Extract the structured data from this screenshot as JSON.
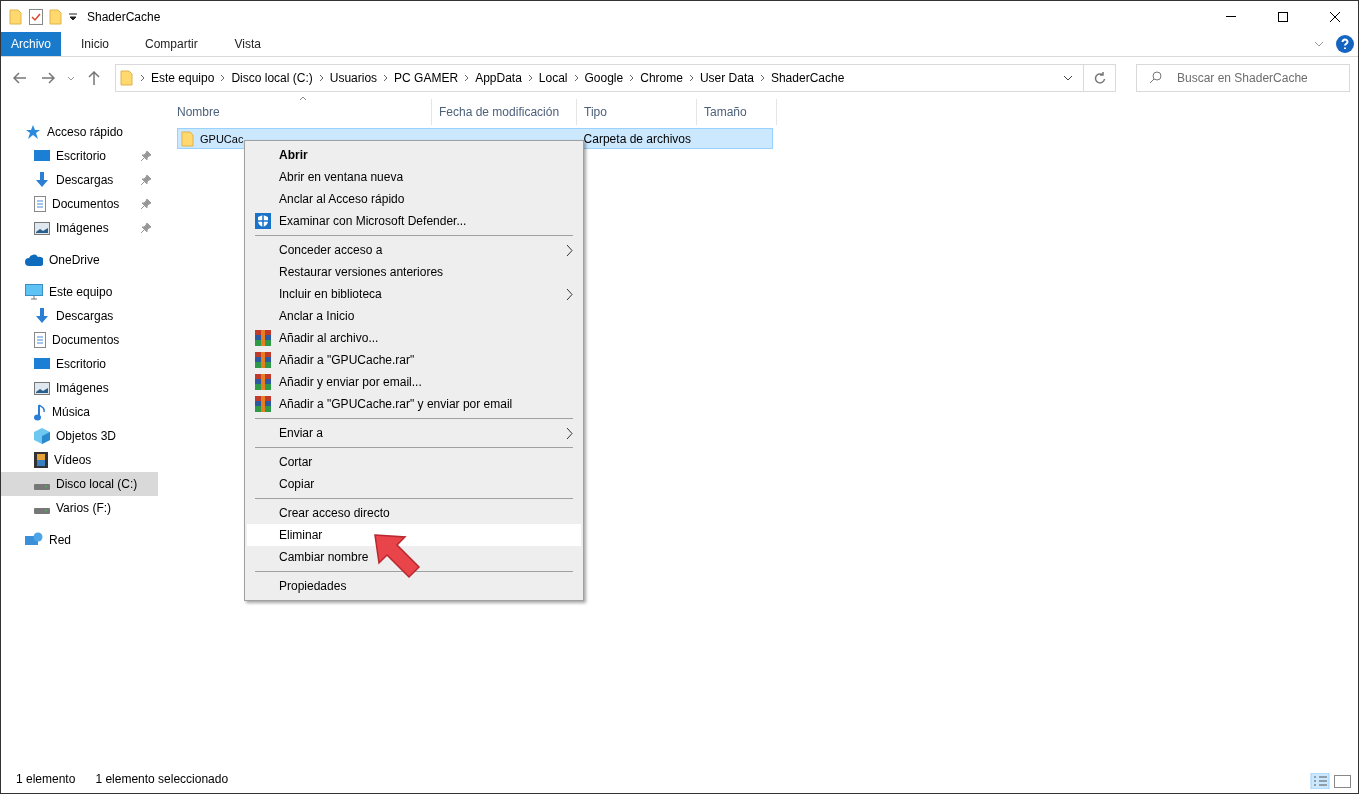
{
  "window": {
    "title": "ShaderCache"
  },
  "ribbon_tabs": [
    {
      "label": "Archivo",
      "selected": true
    },
    {
      "label": "Inicio",
      "selected": false
    },
    {
      "label": "Compartir",
      "selected": false
    },
    {
      "label": "Vista",
      "selected": false
    }
  ],
  "breadcrumb": [
    "Este equipo",
    "Disco local (C:)",
    "Usuarios",
    "PC GAMER",
    "AppData",
    "Local",
    "Google",
    "Chrome",
    "User Data",
    "ShaderCache"
  ],
  "search": {
    "placeholder": "Buscar en ShaderCache"
  },
  "sidebar": {
    "items": [
      {
        "label": "Acceso rápido",
        "kind": "star",
        "selected": false,
        "children": [
          {
            "label": "Escritorio",
            "kind": "desktop",
            "pinned": true,
            "selected": false
          },
          {
            "label": "Descargas",
            "kind": "download",
            "pinned": true,
            "selected": false
          },
          {
            "label": "Documentos",
            "kind": "document",
            "pinned": true,
            "selected": false
          },
          {
            "label": "Imágenes",
            "kind": "image",
            "pinned": true,
            "selected": false
          }
        ]
      },
      {
        "label": "OneDrive",
        "kind": "cloud",
        "selected": false
      },
      {
        "label": "Este equipo",
        "kind": "pc",
        "selected": false,
        "children": [
          {
            "label": "Descargas",
            "kind": "download",
            "selected": false
          },
          {
            "label": "Documentos",
            "kind": "document",
            "selected": false
          },
          {
            "label": "Escritorio",
            "kind": "desktop",
            "selected": false
          },
          {
            "label": "Imágenes",
            "kind": "image",
            "selected": false
          },
          {
            "label": "Música",
            "kind": "music",
            "selected": false
          },
          {
            "label": "Objetos 3D",
            "kind": "cube",
            "selected": false
          },
          {
            "label": "Vídeos",
            "kind": "film",
            "selected": false
          },
          {
            "label": "Disco local (C:)",
            "kind": "drive",
            "selected": true
          },
          {
            "label": "Varios (F:)",
            "kind": "drive",
            "selected": false
          }
        ]
      },
      {
        "label": "Red",
        "kind": "network",
        "selected": false
      }
    ]
  },
  "table": {
    "columns": [
      "Nombre",
      "Fecha de modificación",
      "Tipo",
      "Tamaño"
    ],
    "rows": [
      {
        "name": "GPUCac",
        "type": "Carpeta de archivos",
        "selected": true
      }
    ]
  },
  "context_menu": [
    {
      "kind": "item",
      "label": "Abrir",
      "default": true,
      "selected": false
    },
    {
      "kind": "item",
      "label": "Abrir en ventana nueva",
      "selected": false
    },
    {
      "kind": "item",
      "label": "Anclar al Acceso rápido",
      "selected": false
    },
    {
      "kind": "shield-item",
      "label": "Examinar con Microsoft Defender...",
      "selected": false
    },
    {
      "kind": "separator"
    },
    {
      "kind": "item",
      "label": "Conceder acceso a",
      "submenu": true,
      "selected": false
    },
    {
      "kind": "item",
      "label": "Restaurar versiones anteriores",
      "selected": false
    },
    {
      "kind": "item",
      "label": "Incluir en biblioteca",
      "submenu": true,
      "selected": false
    },
    {
      "kind": "item",
      "label": "Anclar a Inicio",
      "selected": false
    },
    {
      "kind": "archive-item",
      "label": "Añadir al archivo...",
      "selected": false
    },
    {
      "kind": "archive-item",
      "label": "Añadir a \"GPUCache.rar\"",
      "selected": false
    },
    {
      "kind": "archive-item",
      "label": "Añadir y enviar por email...",
      "selected": false
    },
    {
      "kind": "archive-item",
      "label": "Añadir a \"GPUCache.rar\" y enviar por email",
      "selected": false
    },
    {
      "kind": "separator"
    },
    {
      "kind": "item",
      "label": "Enviar a",
      "submenu": true,
      "selected": false
    },
    {
      "kind": "separator"
    },
    {
      "kind": "item",
      "label": "Cortar",
      "selected": false
    },
    {
      "kind": "item",
      "label": "Copiar",
      "selected": false
    },
    {
      "kind": "separator"
    },
    {
      "kind": "item",
      "label": "Crear acceso directo",
      "selected": false
    },
    {
      "kind": "item",
      "label": "Eliminar",
      "selected": true
    },
    {
      "kind": "item",
      "label": "Cambiar nombre",
      "selected": false
    },
    {
      "kind": "separator"
    },
    {
      "kind": "item",
      "label": "Propiedades",
      "selected": false
    }
  ],
  "status_bar": [
    "1 elemento",
    "1 elemento seleccionado"
  ]
}
